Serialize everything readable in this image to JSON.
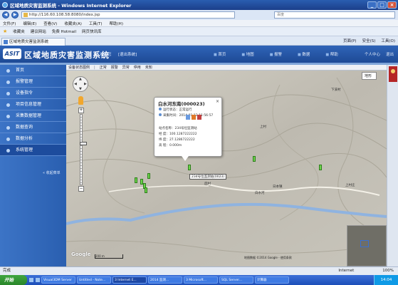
{
  "browser": {
    "title": "区域地质灾害监测系统 - Windows Internet Explorer",
    "address": "http://116.60.108.58:8080/index.jsp",
    "search_placeholder": "百度",
    "menu": [
      "文件(F)",
      "编辑(E)",
      "查看(V)",
      "收藏夹(A)",
      "工具(T)",
      "帮助(H)"
    ],
    "favorites": [
      "收藏夹",
      "建议网站",
      "免费 Hotmail",
      "网页快讯库"
    ],
    "tab_label": "区域地质灾害监测系统",
    "commands": [
      "页面(P)",
      "安全(S)",
      "工具(O)"
    ]
  },
  "app": {
    "logo": "ASIT",
    "name": "区域地质灾害监测系统",
    "welcome": "欢迎您",
    "logout": "[退出系统]",
    "top_links": [
      "首页",
      "地图",
      "报警",
      "数据",
      "帮助"
    ],
    "personal_links": [
      "个人中心",
      "退出"
    ]
  },
  "sidebar": {
    "items": [
      {
        "label": "首页"
      },
      {
        "label": "报警管理"
      },
      {
        "label": "设备指令"
      },
      {
        "label": "项目信息管理"
      },
      {
        "label": "采集数据管理"
      },
      {
        "label": "数据查询"
      },
      {
        "label": "数据分析"
      },
      {
        "label": "系统管理"
      }
    ],
    "active_index": 7,
    "collapse_label": "« 收起菜单"
  },
  "map": {
    "toolbar": [
      "设备状态图例",
      "正常",
      "报警",
      "异常",
      "停用",
      "未知"
    ],
    "maptype": "地形",
    "pan_labels": {
      "up": "▲",
      "down": "▼",
      "left": "◀",
      "right": "▶"
    },
    "zoom_plus": "+",
    "zoom_minus": "−",
    "zoom_level_fraction": 0.6,
    "google": "Google",
    "scale_label": "200 m",
    "attribution": "地图数据 ©2014 Google - 使用条款",
    "labels": [
      "下溪村",
      "上村",
      "日本镇",
      "白水河",
      "后村",
      "上村庄"
    ],
    "station_label": "234号位监测站(0023)"
  },
  "popup": {
    "title": "白水河东南(000023)",
    "status": "运行状态：正常运行",
    "time": "采集时间：2014-01-12 11:56:57",
    "fields": [
      {
        "label": "站点名称：",
        "value": "234号位监测站"
      },
      {
        "label": "经 度：",
        "value": "100.1287222222"
      },
      {
        "label": "纬 度：",
        "value": "27.1286722222"
      },
      {
        "label": "高 程：",
        "value": "0.000m"
      }
    ],
    "close": "×"
  },
  "statusbar": {
    "left": "完成",
    "zone": "Internet",
    "zoom": "100%"
  },
  "taskbar": {
    "start": "开始",
    "tasks": [
      "Visual3DM Server",
      "Untitled - Note...",
      "3 Internet E...",
      "2014 监测... ",
      "3 Microsoft...",
      "SQL Server...",
      "计算器"
    ],
    "clock": "14:04"
  },
  "colors": {
    "accent": "#2f64b8",
    "marker_normal": "#6bd34a",
    "river": "#8fb3e0"
  }
}
